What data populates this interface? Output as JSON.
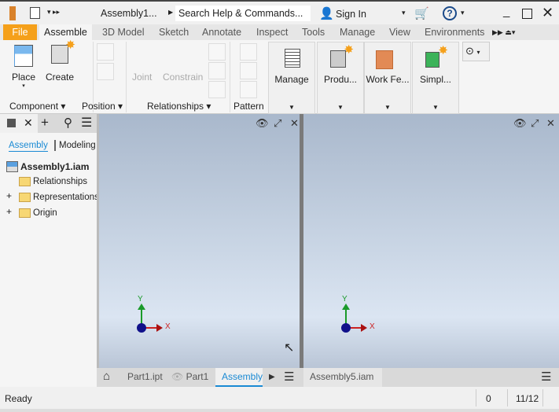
{
  "titlebar": {
    "doc_title": "Assembly1...",
    "search_placeholder": "Search Help & Commands...",
    "sign_in": "Sign In"
  },
  "ribbon_tabs": [
    "File",
    "Assemble",
    "3D Model",
    "Sketch",
    "Annotate",
    "Inspect",
    "Tools",
    "Manage",
    "View",
    "Environments"
  ],
  "ribbon": {
    "place": "Place",
    "create": "Create",
    "joint": "Joint",
    "constrain": "Constrain",
    "manage": "Manage",
    "productivity": "Produ...",
    "work_features": "Work Fe...",
    "simplification": "Simpl...",
    "panels": {
      "component": "Component",
      "position": "Position",
      "relationships": "Relationships",
      "pattern": "Pattern"
    }
  },
  "browser": {
    "tab_assembly": "Assembly",
    "tab_modeling": "Modeling",
    "root": "Assembly1.iam",
    "items": [
      "Relationships",
      "Representations",
      "Origin"
    ]
  },
  "doc_tabs": {
    "left": [
      "Part1.ipt",
      "Part1",
      "Assembly"
    ],
    "right": [
      "Assembly5.iam"
    ]
  },
  "triad": {
    "x": "X",
    "y": "Y"
  },
  "status": {
    "text": "Ready",
    "count": "0",
    "pages": "11/12"
  }
}
